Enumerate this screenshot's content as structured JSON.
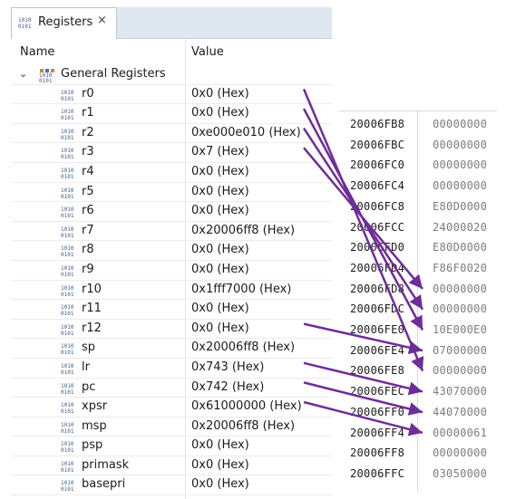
{
  "tab": {
    "label": "Registers",
    "close_icon": "×"
  },
  "columns": {
    "name": "Name",
    "value": "Value"
  },
  "group": {
    "label": "General Registers",
    "chevron": "⌄"
  },
  "registers": [
    {
      "name": "r0",
      "value": "0x0 (Hex)"
    },
    {
      "name": "r1",
      "value": "0x0 (Hex)"
    },
    {
      "name": "r2",
      "value": "0xe000e010 (Hex)"
    },
    {
      "name": "r3",
      "value": "0x7 (Hex)"
    },
    {
      "name": "r4",
      "value": "0x0 (Hex)"
    },
    {
      "name": "r5",
      "value": "0x0 (Hex)"
    },
    {
      "name": "r6",
      "value": "0x0 (Hex)"
    },
    {
      "name": "r7",
      "value": "0x20006ff8 (Hex)"
    },
    {
      "name": "r8",
      "value": "0x0 (Hex)"
    },
    {
      "name": "r9",
      "value": "0x0 (Hex)"
    },
    {
      "name": "r10",
      "value": "0x1fff7000 (Hex)"
    },
    {
      "name": "r11",
      "value": "0x0 (Hex)"
    },
    {
      "name": "r12",
      "value": "0x0 (Hex)"
    },
    {
      "name": "sp",
      "value": "0x20006ff8 (Hex)"
    },
    {
      "name": "lr",
      "value": "0x743 (Hex)"
    },
    {
      "name": "pc",
      "value": "0x742 (Hex)"
    },
    {
      "name": "xpsr",
      "value": "0x61000000 (Hex)"
    },
    {
      "name": "msp",
      "value": "0x20006ff8 (Hex)"
    },
    {
      "name": "psp",
      "value": "0x0 (Hex)"
    },
    {
      "name": "primask",
      "value": "0x0 (Hex)"
    },
    {
      "name": "basepri",
      "value": "0x0 (Hex)"
    }
  ],
  "memory": [
    {
      "addr": "20006FB8",
      "value": "00000000"
    },
    {
      "addr": "20006FBC",
      "value": "00000000"
    },
    {
      "addr": "20006FC0",
      "value": "00000000"
    },
    {
      "addr": "20006FC4",
      "value": "00000000"
    },
    {
      "addr": "20006FC8",
      "value": "E80D0000"
    },
    {
      "addr": "20006FCC",
      "value": "24000020"
    },
    {
      "addr": "20006FD0",
      "value": "E80D0000"
    },
    {
      "addr": "20006FD4",
      "value": "F86F0020"
    },
    {
      "addr": "20006FD8",
      "value": "00000000"
    },
    {
      "addr": "20006FDC",
      "value": "00000000"
    },
    {
      "addr": "20006FE0",
      "value": "10E000E0"
    },
    {
      "addr": "20006FE4",
      "value": "07000000"
    },
    {
      "addr": "20006FE8",
      "value": "00000000"
    },
    {
      "addr": "20006FEC",
      "value": "43070000"
    },
    {
      "addr": "20006FF0",
      "value": "44070000"
    },
    {
      "addr": "20006FF4",
      "value": "00000061"
    },
    {
      "addr": "20006FF8",
      "value": "00000000"
    },
    {
      "addr": "20006FFC",
      "value": "03050000"
    }
  ],
  "register_icon": {
    "top": "1010",
    "bottom": "0101"
  },
  "arrow_color": "#6f2d98",
  "arrow_links": [
    {
      "register": "r0",
      "address": "20006FE8"
    },
    {
      "register": "r1",
      "address": "20006FE0"
    },
    {
      "register": "r2",
      "address": "20006FDC"
    },
    {
      "register": "r3",
      "address": "20006FD8"
    },
    {
      "register": "r12",
      "address": "20006FE4"
    },
    {
      "register": "lr",
      "address": "20006FEC"
    },
    {
      "register": "pc",
      "address": "20006FF0"
    },
    {
      "register": "xpsr",
      "address": "20006FF4"
    }
  ]
}
